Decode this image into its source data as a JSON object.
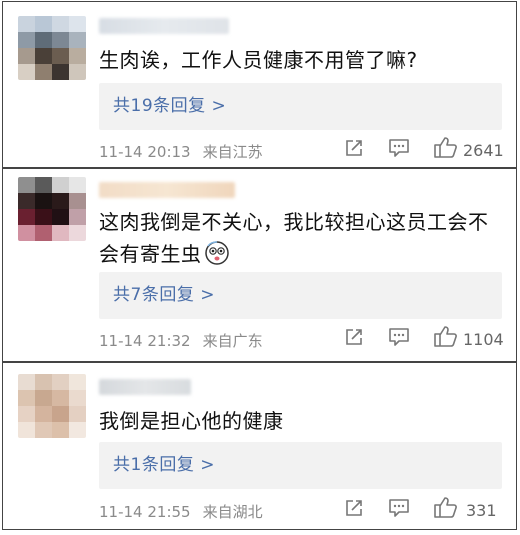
{
  "comments": [
    {
      "text": "生肉诶，工作人员健康不用管了嘛?",
      "replies_label": "共19条回复 >",
      "time": "11-14 20:13",
      "location": "来自江苏",
      "likes": "2641"
    },
    {
      "text": "这肉我倒是不关心，我比较担心这员工会不会有寄生虫",
      "replies_label": "共7条回复 >",
      "time": "11-14 21:32",
      "location": "来自广东",
      "likes": "1104"
    },
    {
      "text": "我倒是担心他的健康",
      "replies_label": "共1条回复 >",
      "time": "11-14 21:55",
      "location": "来自湖北",
      "likes": "331"
    }
  ],
  "icons": {
    "share": "share-icon",
    "comment": "comment-icon",
    "like": "thumbs-up-icon",
    "emoji": "scared-emoji-icon"
  }
}
